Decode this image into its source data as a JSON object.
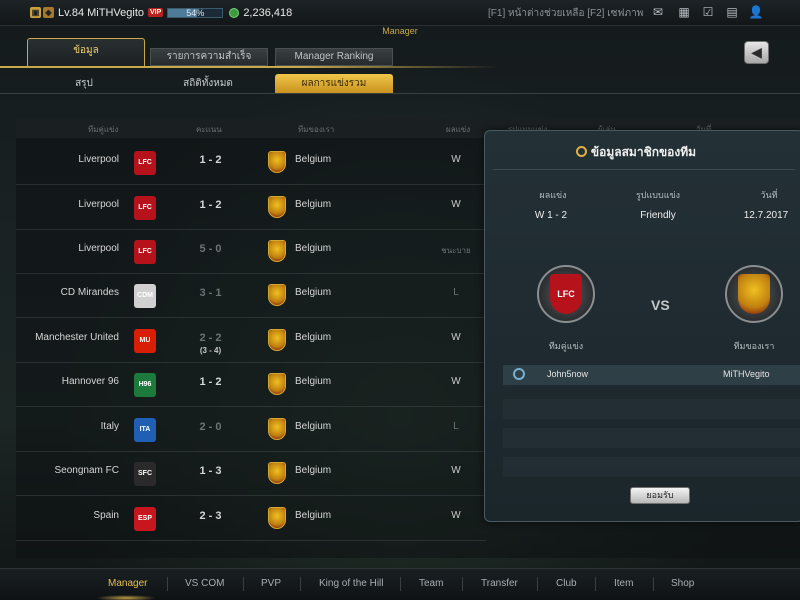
{
  "topbar": {
    "level": "Lv.84 MiTHVegito",
    "vip": "VIP",
    "exp_percent": "54%",
    "exp_fraction": 0.54,
    "money": "2,236,418",
    "help_text": "[F1] หน้าต่างช่วยเหลือ [F2] เซฟภาพ",
    "icons": [
      "mail-icon",
      "calendar-icon",
      "checklist-icon",
      "chat-icon",
      "profile-icon"
    ]
  },
  "header": {
    "screen_title": "Manager",
    "tabs": [
      "ข้อมูล",
      "รายการความสำเร็จ",
      "Manager Ranking"
    ],
    "back_icon": "back-arrow-icon",
    "subtabs": [
      "สรุป",
      "สถิติทั้งหมด",
      "ผลการแข่งรวม"
    ]
  },
  "table": {
    "headers": [
      "ทีมคู่แข่ง",
      "คะแนน",
      "ทีมของเรา",
      "ผลแข่ง",
      "รูปแบบแข่ง",
      "ผู้เล่น",
      "วันที่"
    ],
    "rows": [
      {
        "opponent": "Liverpool",
        "crest_label": "LFC",
        "score": "1 - 2",
        "score_dim": false,
        "penalties": "",
        "our_team": "Belgium",
        "result": "W",
        "result_dim": false,
        "crest_color": "#b5121b"
      },
      {
        "opponent": "Liverpool",
        "crest_label": "LFC",
        "score": "1 - 2",
        "score_dim": false,
        "penalties": "",
        "our_team": "Belgium",
        "result": "W",
        "result_dim": false,
        "crest_color": "#b5121b"
      },
      {
        "opponent": "Liverpool",
        "crest_label": "LFC",
        "score": "5 - 0",
        "score_dim": true,
        "penalties": "",
        "our_team": "Belgium",
        "result": "ชนะบาย",
        "result_dim": true,
        "crest_color": "#b5121b"
      },
      {
        "opponent": "CD Mirandes",
        "crest_label": "CDM",
        "score": "3 - 1",
        "score_dim": true,
        "penalties": "",
        "our_team": "Belgium",
        "result": "L",
        "result_dim": true,
        "crest_color": "#d0d0d0"
      },
      {
        "opponent": "Manchester United",
        "crest_label": "MU",
        "score": "2 - 2",
        "score_dim": true,
        "penalties": "(3 - 4)",
        "our_team": "Belgium",
        "result": "W",
        "result_dim": false,
        "crest_color": "#d81e05"
      },
      {
        "opponent": "Hannover 96",
        "crest_label": "H96",
        "score": "1 - 2",
        "score_dim": false,
        "penalties": "",
        "our_team": "Belgium",
        "result": "W",
        "result_dim": false,
        "crest_color": "#1c7a3c"
      },
      {
        "opponent": "Italy",
        "crest_label": "ITA",
        "score": "2 - 0",
        "score_dim": true,
        "penalties": "",
        "our_team": "Belgium",
        "result": "L",
        "result_dim": true,
        "crest_color": "#1f5fb4"
      },
      {
        "opponent": "Seongnam FC",
        "crest_label": "SFC",
        "score": "1 - 3",
        "score_dim": false,
        "penalties": "",
        "our_team": "Belgium",
        "result": "W",
        "result_dim": false,
        "crest_color": "#2a2a2a"
      },
      {
        "opponent": "Spain",
        "crest_label": "ESP",
        "score": "2 - 3",
        "score_dim": false,
        "penalties": "",
        "our_team": "Belgium",
        "result": "W",
        "result_dim": false,
        "crest_color": "#c8161e"
      }
    ]
  },
  "popup": {
    "title": "ข้อมูลสมาชิกของทีม",
    "headers": [
      "ผลแข่ง",
      "รูปแบบแข่ง",
      "วันที่"
    ],
    "values": [
      "W  1 - 2",
      "Friendly",
      "12.7.2017"
    ],
    "vs": "VS",
    "opponent_label": "ทีมคู่แข่ง",
    "our_label": "ทีมของเรา",
    "opponent_crest": "LFC",
    "member_left": "John5now",
    "member_right": "MiTHVegito",
    "ok": "ยอมรับ"
  },
  "bottom_nav": [
    "Manager",
    "VS COM",
    "PVP",
    "King of the Hill",
    "Team",
    "Transfer",
    "Club",
    "Item",
    "Shop"
  ],
  "colors": {
    "accent_gold": "#c9a84a",
    "active_tab": "#f0c64a",
    "vip_red": "#b62222"
  }
}
